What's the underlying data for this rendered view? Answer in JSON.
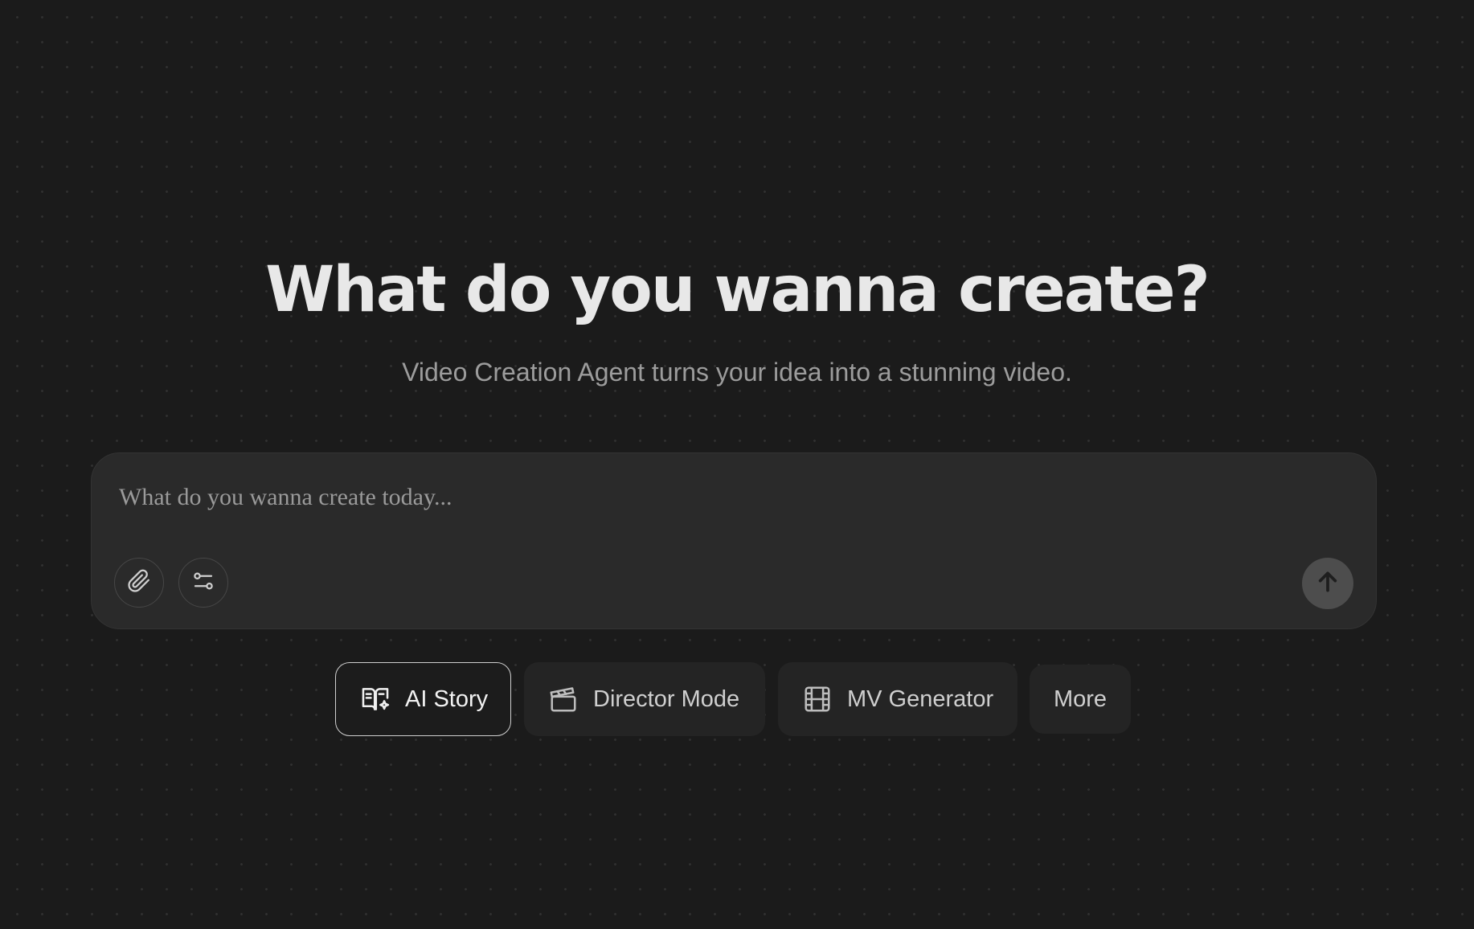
{
  "hero": {
    "title": "What do you wanna create?",
    "subtitle": "Video Creation Agent turns your idea into a stunning video."
  },
  "composer": {
    "placeholder": "What do you wanna create today...",
    "value": "",
    "attach_icon": "paperclip-icon",
    "settings_icon": "sliders-icon",
    "send_icon": "arrow-up-icon"
  },
  "modes": [
    {
      "label": "AI Story",
      "icon": "book-sparkle-icon",
      "selected": true
    },
    {
      "label": "Director Mode",
      "icon": "clapperboard-icon",
      "selected": false
    },
    {
      "label": "MV Generator",
      "icon": "film-strip-icon",
      "selected": false
    },
    {
      "label": "More",
      "icon": null,
      "selected": false
    }
  ],
  "colors": {
    "background": "#1b1b1b",
    "composer_bg": "#2a2a2a",
    "send_button_bg": "#4d4d4d",
    "title_text": "#e8e8e8",
    "subtitle_text": "#9c9c9c"
  }
}
